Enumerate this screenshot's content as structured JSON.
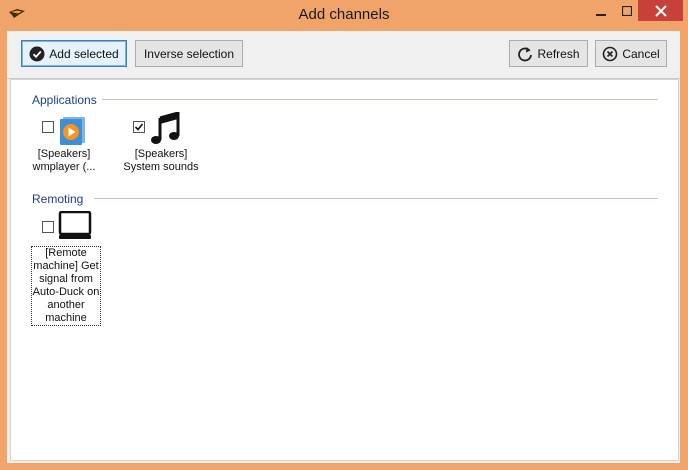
{
  "window": {
    "title": "Add channels"
  },
  "toolbar": {
    "add_selected_label": "Add selected",
    "inverse_selection_label": "Inverse selection",
    "refresh_label": "Refresh",
    "cancel_label": "Cancel"
  },
  "groups": [
    {
      "label": "Applications",
      "items": [
        {
          "label_line1": "[Speakers]",
          "label_line2": "wmplayer (...",
          "checked": false,
          "icon": "media-player-icon"
        },
        {
          "label_line1": "[Speakers]",
          "label_line2": "System sounds",
          "checked": true,
          "icon": "music-note-icon"
        }
      ]
    },
    {
      "label": "Remoting",
      "items": [
        {
          "label_lines": [
            "[Remote",
            "machine] Get",
            "signal from",
            "Auto-Duck on",
            "another",
            "machine"
          ],
          "checked": false,
          "icon": "monitor-icon"
        }
      ]
    }
  ],
  "colors": {
    "title_bar": "#f0a46a",
    "close_button": "#c7403a",
    "group_header_text": "#1e3d8f"
  }
}
